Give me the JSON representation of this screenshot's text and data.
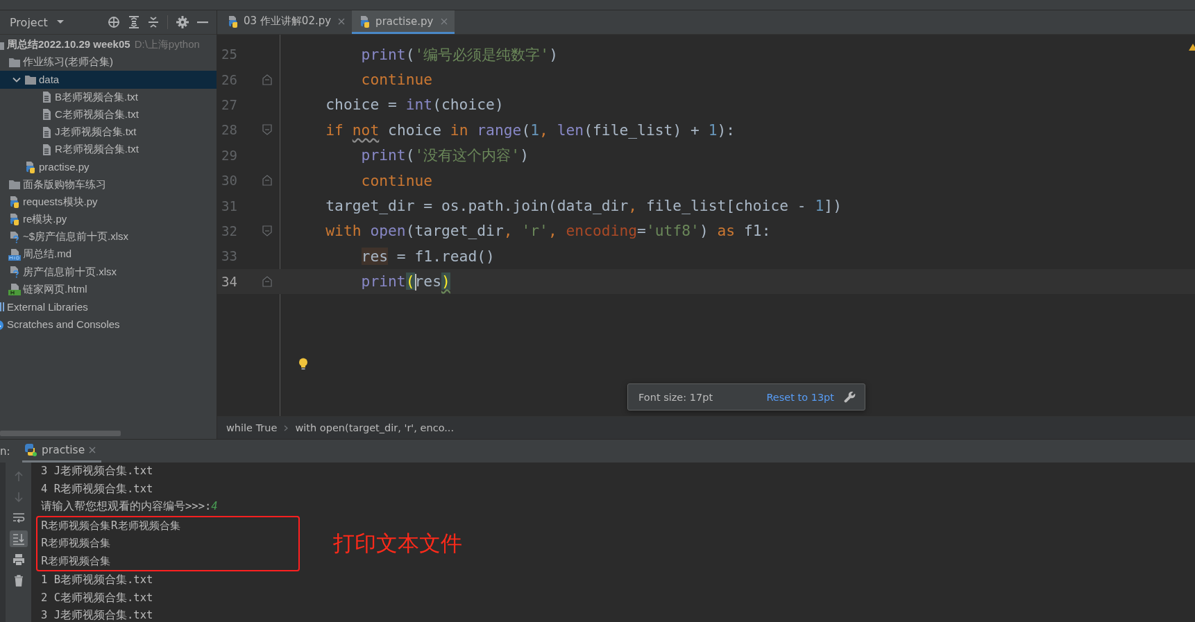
{
  "sidebar": {
    "title": "Project",
    "tree": [
      {
        "label": "周总结2022.10.29 week05",
        "path": "D:\\上海python",
        "kind": "folder",
        "selected": false,
        "children": [
          {
            "label": "作业练习(老师合集)",
            "kind": "folder",
            "selected": false,
            "children": [
              {
                "label": "data",
                "kind": "folder",
                "expanded": true,
                "selected": true,
                "children": [
                  {
                    "label": "B老师视频合集.txt",
                    "kind": "text",
                    "selected": false
                  },
                  {
                    "label": "C老师视频合集.txt",
                    "kind": "text",
                    "selected": false
                  },
                  {
                    "label": "J老师视频合集.txt",
                    "kind": "text",
                    "selected": false
                  },
                  {
                    "label": "R老师视频合集.txt",
                    "kind": "text",
                    "selected": false
                  }
                ]
              },
              {
                "label": "practise.py",
                "kind": "python",
                "selected": false
              }
            ]
          },
          {
            "label": "面条版购物车练习",
            "kind": "folder",
            "selected": false
          },
          {
            "label": "requests模块.py",
            "kind": "python",
            "selected": false
          },
          {
            "label": "re模块.py",
            "kind": "python",
            "selected": false
          },
          {
            "label": "~$房产信息前十页.xlsx",
            "kind": "unknown",
            "selected": false
          },
          {
            "label": "周总结.md",
            "kind": "markdown",
            "selected": false
          },
          {
            "label": "房产信息前十页.xlsx",
            "kind": "unknown",
            "selected": false
          },
          {
            "label": "链家网页.html",
            "kind": "html",
            "selected": false
          }
        ]
      },
      {
        "label": "External Libraries",
        "kind": "library",
        "selected": false
      },
      {
        "label": "Scratches and Consoles",
        "kind": "scratches",
        "selected": false
      }
    ]
  },
  "tabs": [
    {
      "label": "03 作业讲解02.py",
      "selected": false
    },
    {
      "label": "practise.py",
      "selected": true
    }
  ],
  "editor": {
    "lines": [
      {
        "number": "25",
        "current": false,
        "tokens": [
          {
            "text": "        print",
            "kind": "builtin"
          },
          {
            "text": "(",
            "kind": "plain"
          },
          {
            "text": "'编号必须是纯数字'",
            "kind": "string"
          },
          {
            "text": ")",
            "kind": "plain"
          }
        ]
      },
      {
        "number": "26",
        "current": false,
        "fold_end": true,
        "tokens": [
          {
            "text": "        continue",
            "kind": "keyword"
          }
        ]
      },
      {
        "number": "27",
        "current": false,
        "tokens": [
          {
            "text": "    choice = ",
            "kind": "plain"
          },
          {
            "text": "int",
            "kind": "builtin"
          },
          {
            "text": "(choice)",
            "kind": "plain"
          }
        ]
      },
      {
        "number": "28",
        "current": false,
        "fold_start": true,
        "tokens": [
          {
            "text": "    if ",
            "kind": "keyword"
          },
          {
            "text": "not",
            "kind": "keyword",
            "warning": true
          },
          {
            "text": " choice ",
            "kind": "plain"
          },
          {
            "text": "in ",
            "kind": "keyword"
          },
          {
            "text": "range",
            "kind": "builtin"
          },
          {
            "text": "(",
            "kind": "plain"
          },
          {
            "text": "1",
            "kind": "number"
          },
          {
            "text": ", ",
            "kind": "keyword"
          },
          {
            "text": "len",
            "kind": "builtin"
          },
          {
            "text": "(file_list) + ",
            "kind": "plain"
          },
          {
            "text": "1",
            "kind": "number"
          },
          {
            "text": "):",
            "kind": "plain"
          }
        ]
      },
      {
        "number": "29",
        "current": false,
        "tokens": [
          {
            "text": "        print",
            "kind": "builtin"
          },
          {
            "text": "(",
            "kind": "plain"
          },
          {
            "text": "'没有这个内容'",
            "kind": "string"
          },
          {
            "text": ")",
            "kind": "plain"
          }
        ]
      },
      {
        "number": "30",
        "current": false,
        "fold_end": true,
        "tokens": [
          {
            "text": "        continue",
            "kind": "keyword"
          }
        ]
      },
      {
        "number": "31",
        "current": false,
        "tokens": [
          {
            "text": "    target_dir = os.path.join(data_dir",
            "kind": "plain"
          },
          {
            "text": ", ",
            "kind": "keyword"
          },
          {
            "text": "file_list[choice - ",
            "kind": "plain"
          },
          {
            "text": "1",
            "kind": "number"
          },
          {
            "text": "])",
            "kind": "plain"
          }
        ]
      },
      {
        "number": "32",
        "current": false,
        "fold_start": true,
        "tokens": [
          {
            "text": "    with ",
            "kind": "keyword"
          },
          {
            "text": "open",
            "kind": "builtin"
          },
          {
            "text": "(target_dir",
            "kind": "plain"
          },
          {
            "text": ", ",
            "kind": "keyword"
          },
          {
            "text": "'r'",
            "kind": "string"
          },
          {
            "text": ", ",
            "kind": "keyword"
          },
          {
            "text": "encoding",
            "kind": "param"
          },
          {
            "text": "=",
            "kind": "plain"
          },
          {
            "text": "'utf8'",
            "kind": "string"
          },
          {
            "text": ") ",
            "kind": "plain"
          },
          {
            "text": "as ",
            "kind": "keyword"
          },
          {
            "text": "f1:",
            "kind": "plain"
          }
        ]
      },
      {
        "number": "33",
        "current": false,
        "tokens": [
          {
            "text": "        res",
            "kind": "usage"
          },
          {
            "text": " = f1.read()",
            "kind": "plain"
          }
        ]
      },
      {
        "number": "34",
        "current": true,
        "fold_end": true,
        "tokens": [
          {
            "text": "        print",
            "kind": "builtin"
          },
          {
            "text": "(",
            "kind": "brace"
          },
          {
            "text": "res",
            "kind": "plain",
            "caret": true
          },
          {
            "text": ")",
            "kind": "brace",
            "warning": true
          }
        ]
      }
    ]
  },
  "font_popup": {
    "text": "Font size: 17pt",
    "link": "Reset to 13pt"
  },
  "breadcrumbs": [
    "while True",
    "with open(target_dir, 'r', enco..."
  ],
  "run": {
    "label": "n:",
    "tab": {
      "label": "practise",
      "selected": true
    }
  },
  "console": {
    "toolbar": [
      {
        "kind": "up",
        "selected": false
      },
      {
        "kind": "down",
        "selected": false
      },
      {
        "kind": "wrap",
        "selected": false
      },
      {
        "kind": "scroll-end",
        "selected": true
      },
      {
        "kind": "print",
        "selected": false
      },
      {
        "kind": "trash",
        "selected": false
      }
    ],
    "lines_before": [
      {
        "text": "3 J老师视频合集.txt"
      },
      {
        "text": "4 R老师视频合集.txt"
      },
      {
        "text": "请输入帮您想观看的内容编号>>>:",
        "input": "4"
      }
    ],
    "boxed_lines": [
      {
        "text": "R老师视频合集R老师视频合集"
      },
      {
        "text": "R老师视频合集"
      },
      {
        "text": "R老师视频合集"
      }
    ],
    "annotation": "打印文本文件",
    "lines_after": [
      {
        "text": "1 B老师视频合集.txt"
      },
      {
        "text": "2 C老师视频合集.txt"
      },
      {
        "text": "3 J老师视频合集.txt"
      }
    ]
  }
}
